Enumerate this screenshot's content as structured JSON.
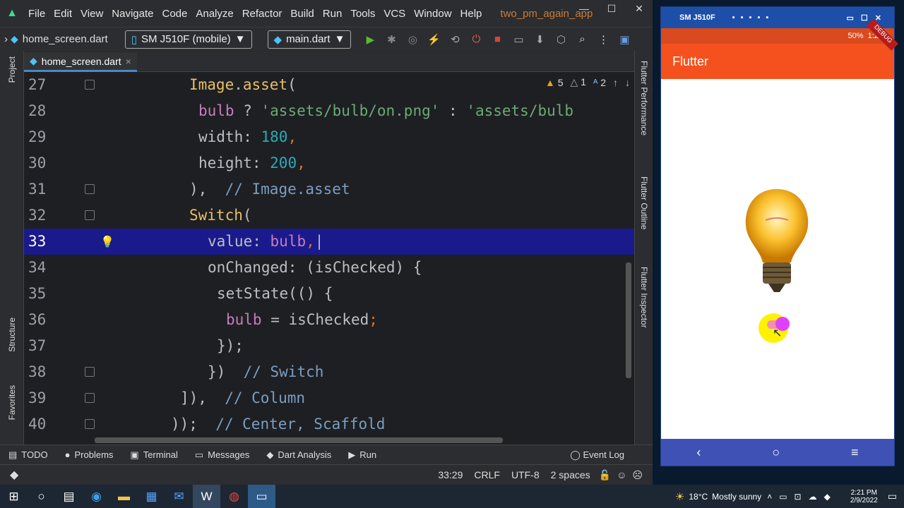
{
  "ide": {
    "menu": [
      "File",
      "Edit",
      "View",
      "Navigate",
      "Code",
      "Analyze",
      "Refactor",
      "Build",
      "Run",
      "Tools",
      "VCS",
      "Window",
      "Help"
    ],
    "project_name": "two_pm_again_app",
    "window_controls": {
      "minimize": "—",
      "maximize": "☐",
      "close": "✕"
    }
  },
  "toolbar": {
    "breadcrumb_prefix": "›",
    "breadcrumb_file": "home_screen.dart",
    "device_label": "SM J510F (mobile)",
    "run_config": "main.dart"
  },
  "tab": {
    "label": "home_screen.dart",
    "close": "×"
  },
  "left_tools": {
    "project": "Project",
    "structure": "Structure",
    "favorites": "Favorites"
  },
  "right_tools": {
    "performance": "Flutter Performance",
    "outline": "Flutter Outline",
    "inspector": "Flutter Inspector"
  },
  "inspections": {
    "warnings": "5",
    "weak_warnings": "1",
    "typos": "2"
  },
  "editor": {
    "lines": [
      {
        "n": "27",
        "parts": [
          [
            "k-cls",
            "Image"
          ],
          [
            "",
            "."
          ],
          [
            "k-cls",
            "asset"
          ],
          [
            "",
            "("
          ]
        ],
        "indent": 10
      },
      {
        "n": "28",
        "parts": [
          [
            "k-prop",
            "bulb"
          ],
          [
            "",
            " ? "
          ],
          [
            "k-str",
            "'assets/bulb/on.png'"
          ],
          [
            "",
            " : "
          ],
          [
            "k-str",
            "'assets/bulb"
          ]
        ],
        "indent": 11
      },
      {
        "n": "29",
        "parts": [
          [
            "",
            "width: "
          ],
          [
            "k-num",
            "180"
          ],
          [
            "k-pun",
            ","
          ]
        ],
        "indent": 11
      },
      {
        "n": "30",
        "parts": [
          [
            "",
            "height: "
          ],
          [
            "k-num",
            "200"
          ],
          [
            "k-pun",
            ","
          ]
        ],
        "indent": 11
      },
      {
        "n": "31",
        "parts": [
          [
            "",
            "),"
          ],
          [
            "",
            "  "
          ],
          [
            "k-cmt",
            "// Image.asset"
          ]
        ],
        "indent": 10
      },
      {
        "n": "32",
        "parts": [
          [
            "k-cls",
            "Switch"
          ],
          [
            "",
            "("
          ]
        ],
        "indent": 10
      },
      {
        "n": "33",
        "parts": [
          [
            "",
            "value: "
          ],
          [
            "k-prop",
            "bulb"
          ],
          [
            "k-pun",
            ","
          ],
          [
            "",
            "|"
          ]
        ],
        "indent": 12,
        "active": true
      },
      {
        "n": "34",
        "parts": [
          [
            "",
            "onChanged: (isChecked) {"
          ]
        ],
        "indent": 12
      },
      {
        "n": "35",
        "parts": [
          [
            "",
            "setState(() {"
          ]
        ],
        "indent": 13
      },
      {
        "n": "36",
        "parts": [
          [
            "k-prop",
            "bulb"
          ],
          [
            "",
            " = isChecked"
          ],
          [
            "k-pun",
            ";"
          ]
        ],
        "indent": 14
      },
      {
        "n": "37",
        "parts": [
          [
            "",
            "});"
          ]
        ],
        "indent": 13
      },
      {
        "n": "38",
        "parts": [
          [
            "",
            "})"
          ],
          [
            "",
            "  "
          ],
          [
            "k-cmt",
            "// Switch"
          ]
        ],
        "indent": 12
      },
      {
        "n": "39",
        "parts": [
          [
            "",
            "]),"
          ],
          [
            "",
            "  "
          ],
          [
            "k-cmt",
            "// Column"
          ]
        ],
        "indent": 9
      },
      {
        "n": "40",
        "parts": [
          [
            "",
            "));"
          ],
          [
            "",
            "  "
          ],
          [
            "k-cmt",
            "// Center, Scaffold"
          ]
        ],
        "indent": 8
      }
    ]
  },
  "bottom_tools": [
    "TODO",
    "Problems",
    "Terminal",
    "Messages",
    "Dart Analysis",
    "Run"
  ],
  "event_log": "Event Log",
  "status": {
    "position": "33:29",
    "line_sep": "CRLF",
    "encoding": "UTF-8",
    "indent": "2 spaces"
  },
  "phone": {
    "device_title": "SM J510F",
    "battery": "50%",
    "time": "1:21",
    "debug_banner": "DEBUG",
    "appbar_title": "Flutter",
    "switch_on": true,
    "nav": {
      "back": "‹",
      "home": "○",
      "menu": "≡"
    }
  },
  "taskbar": {
    "weather_temp": "18°C",
    "weather_text": "Mostly sunny",
    "clock_time": "2:21 PM",
    "clock_date": "2/9/2022"
  },
  "colors": {
    "accent": "#4a88c7",
    "appbar": "#f4511e",
    "phone_nav": "#3f51b5",
    "highlight_line": "#1a1a8c"
  }
}
